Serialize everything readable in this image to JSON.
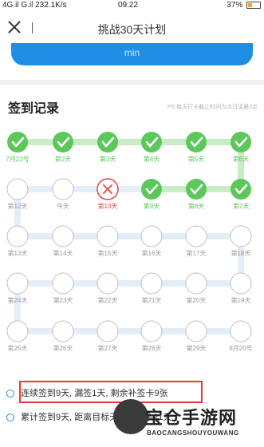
{
  "status_bar": {
    "network": "4G.il G.il 232.1K/s",
    "time": "09:22",
    "battery_percent": "37%",
    "battery_level": 0.37
  },
  "header": {
    "title": "挑战30天计划"
  },
  "banner": {
    "unit": "min"
  },
  "checkin": {
    "title": "签到记录",
    "note": "PS:每天打卡截止时间为次日凌晨3点",
    "rows": [
      [
        {
          "label": "7月22号",
          "state": "checked"
        },
        {
          "label": "第2天",
          "state": "checked"
        },
        {
          "label": "第3天",
          "state": "checked"
        },
        {
          "label": "第4天",
          "state": "checked"
        },
        {
          "label": "第5天",
          "state": "checked"
        },
        {
          "label": "第6天",
          "state": "checked"
        }
      ],
      [
        {
          "label": "第12天",
          "state": "empty"
        },
        {
          "label": "今天",
          "state": "empty"
        },
        {
          "label": "第10天",
          "state": "missed"
        },
        {
          "label": "第9天",
          "state": "checked"
        },
        {
          "label": "第8天",
          "state": "checked"
        },
        {
          "label": "第7天",
          "state": "checked"
        }
      ],
      [
        {
          "label": "第13天",
          "state": "empty"
        },
        {
          "label": "第14天",
          "state": "empty"
        },
        {
          "label": "第15天",
          "state": "empty"
        },
        {
          "label": "第16天",
          "state": "empty"
        },
        {
          "label": "第17天",
          "state": "empty"
        },
        {
          "label": "第18天",
          "state": "empty"
        }
      ],
      [
        {
          "label": "第24天",
          "state": "empty"
        },
        {
          "label": "第23天",
          "state": "empty"
        },
        {
          "label": "第22天",
          "state": "empty"
        },
        {
          "label": "第21天",
          "state": "empty"
        },
        {
          "label": "第20天",
          "state": "empty"
        },
        {
          "label": "第19天",
          "state": "empty"
        }
      ],
      [
        {
          "label": "第25天",
          "state": "empty"
        },
        {
          "label": "第26天",
          "state": "empty"
        },
        {
          "label": "第27天",
          "state": "empty"
        },
        {
          "label": "第28天",
          "state": "empty"
        },
        {
          "label": "第29天",
          "state": "empty"
        },
        {
          "label": "8月20号",
          "state": "empty"
        }
      ]
    ]
  },
  "summary": {
    "line1": "连续签到9天, 漏签1天, 剩余补签卡9张",
    "line2": "累计签到9天, 距离目标天数还剩余21天"
  },
  "watermark": {
    "title": "宝仓手游网",
    "subtitle": "BAOCANGSHOUYOUWANG"
  },
  "colors": {
    "checked": "#5cc85a",
    "connector_done": "#c8ecc6",
    "connector_pending": "#e3eef9",
    "empty_border": "#bfbfbf",
    "missed": "#e8463f",
    "accent": "#1f8fe6",
    "highlight": "#e53935"
  },
  "icons": {
    "check": "check-icon",
    "cross": "cross-icon",
    "close": "close-icon"
  }
}
